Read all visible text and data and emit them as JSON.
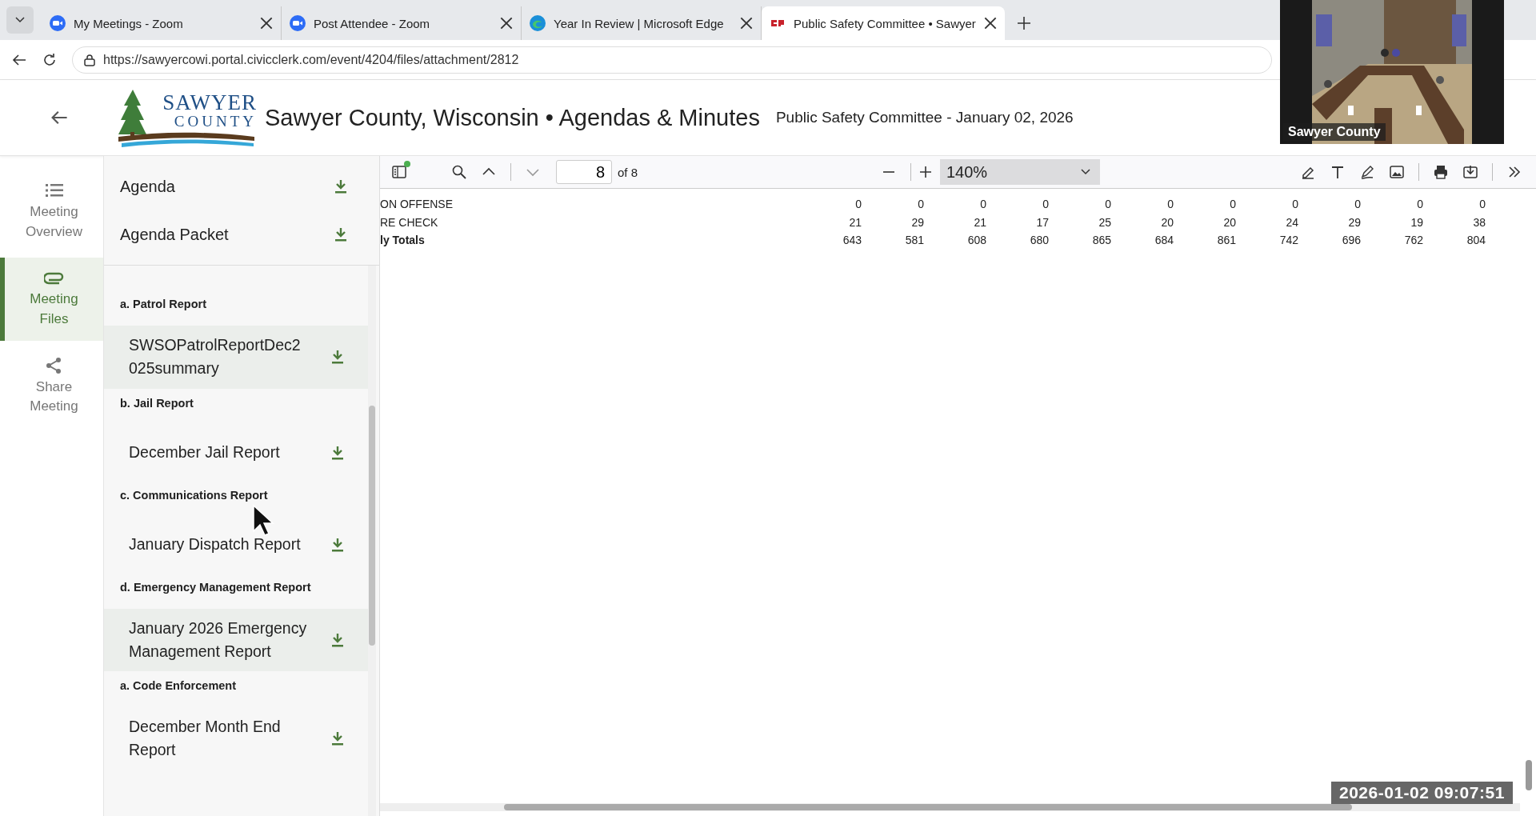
{
  "browser": {
    "tabs": [
      {
        "title": "My Meetings - Zoom",
        "kind": "zoom",
        "selected": false
      },
      {
        "title": "Post Attendee - Zoom",
        "kind": "zoom",
        "selected": false
      },
      {
        "title": "Year In Review | Microsoft Edge",
        "kind": "edge",
        "selected": false
      },
      {
        "title": "Public Safety Committee • Sawyer",
        "kind": "clerk",
        "selected": true
      }
    ],
    "address": "https://sawyercowi.portal.civicclerk.com/event/4204/files/attachment/2812"
  },
  "header": {
    "logo": {
      "top": "SAWYER",
      "bottom": "COUNTY"
    },
    "title": "Sawyer County, Wisconsin • Agendas & Minutes",
    "subtitle": "Public Safety Committee - January 02, 2026"
  },
  "nav": [
    {
      "label": "Meeting Overview",
      "kind": "list",
      "selected": false
    },
    {
      "label": "Meeting Files",
      "kind": "clip",
      "selected": true
    },
    {
      "label": "Share Meeting",
      "kind": "share",
      "selected": false
    }
  ],
  "files": {
    "top": [
      {
        "name": "Agenda"
      },
      {
        "name": "Agenda Packet"
      }
    ],
    "sections": [
      {
        "heading": "a. Patrol Report",
        "files": [
          {
            "name": "SWSOPatrolReportDec2025summary",
            "selected": true
          }
        ]
      },
      {
        "heading": "b. Jail Report",
        "files": [
          {
            "name": "December Jail Report",
            "selected": false
          }
        ]
      },
      {
        "heading": "c. Communications Report",
        "files": [
          {
            "name": "January Dispatch Report",
            "selected": false
          }
        ]
      },
      {
        "heading": "d. Emergency Management Report",
        "files": [
          {
            "name": "January 2026 Emergency Management Report",
            "selected": true
          }
        ]
      },
      {
        "heading": "a. Code Enforcement",
        "files": [
          {
            "name": "December Month End Report",
            "selected": false
          }
        ]
      }
    ]
  },
  "viewer": {
    "page": "8",
    "page_count": "of 8",
    "zoom": "140%",
    "rows": [
      {
        "label": "ON OFFENSE",
        "kind": "data",
        "values": [
          "0",
          "0",
          "0",
          "0",
          "0",
          "0",
          "0",
          "0",
          "0",
          "0",
          "0"
        ]
      },
      {
        "label": "RE CHECK",
        "kind": "data",
        "values": [
          "21",
          "29",
          "21",
          "17",
          "25",
          "20",
          "20",
          "24",
          "29",
          "19",
          "38"
        ]
      },
      {
        "label": "ly Totals",
        "kind": "total",
        "values": [
          "643",
          "581",
          "608",
          "680",
          "865",
          "684",
          "861",
          "742",
          "696",
          "762",
          "804"
        ]
      }
    ]
  },
  "video": {
    "label": "Sawyer County"
  },
  "timestamp": "2026-01-02 09:07:51"
}
